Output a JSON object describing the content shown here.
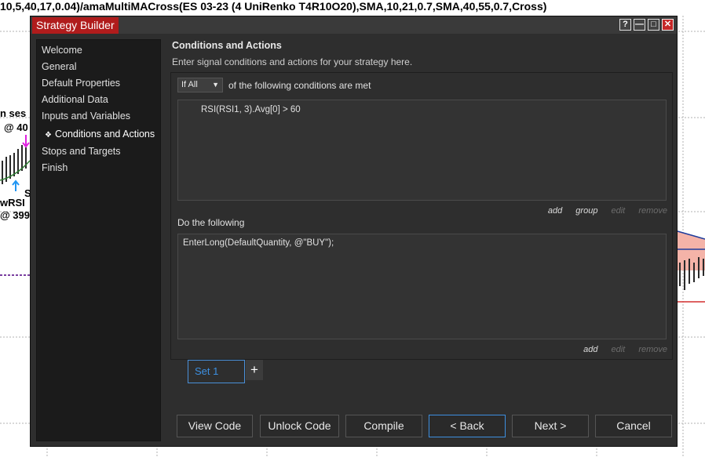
{
  "background": {
    "chart_title": "10,5,40,17,0.04)/amaMultiMACross(ES 03-23 (4 UniRenko T4R10O20),SMA,10,21,0.7,SMA,40,55,0.7,Cross)",
    "fragments": [
      "n ses",
      "@ 40",
      "S",
      "wRSI",
      "@ 399"
    ]
  },
  "dialog": {
    "title": "Strategy Builder",
    "window_buttons": [
      "?",
      "—",
      "□",
      "✕"
    ]
  },
  "sidebar": {
    "items": [
      {
        "label": "Welcome"
      },
      {
        "label": "General"
      },
      {
        "label": "Default Properties"
      },
      {
        "label": "Additional Data"
      },
      {
        "label": "Inputs and Variables"
      },
      {
        "label": "Conditions and Actions",
        "active": true
      },
      {
        "label": "Stops and Targets"
      },
      {
        "label": "Finish"
      }
    ]
  },
  "main": {
    "section_title": "Conditions and Actions",
    "section_subtitle": "Enter signal conditions and actions for your strategy here.",
    "conditions": {
      "select_value": "If All",
      "label": "of the following conditions are met",
      "items": [
        "RSI(RSI1, 3).Avg[0] > 60"
      ],
      "links": [
        "add",
        "group",
        "edit",
        "remove"
      ]
    },
    "actions": {
      "label": "Do the following",
      "items": [
        "EnterLong(DefaultQuantity, @\"BUY\");"
      ],
      "links": [
        "add",
        "edit",
        "remove"
      ]
    },
    "sets": [
      {
        "label": "Set 1"
      }
    ],
    "add_set_label": "+"
  },
  "buttons": {
    "view_code": "View Code",
    "unlock_code": "Unlock Code",
    "compile": "Compile",
    "back": "< Back",
    "next": "Next >",
    "cancel": "Cancel"
  },
  "colors": {
    "accent": "#3d8fe0",
    "title_tab": "#b01c1c",
    "dialog_bg": "#2e2e2e",
    "sidebar_bg": "#1b1b1b"
  }
}
